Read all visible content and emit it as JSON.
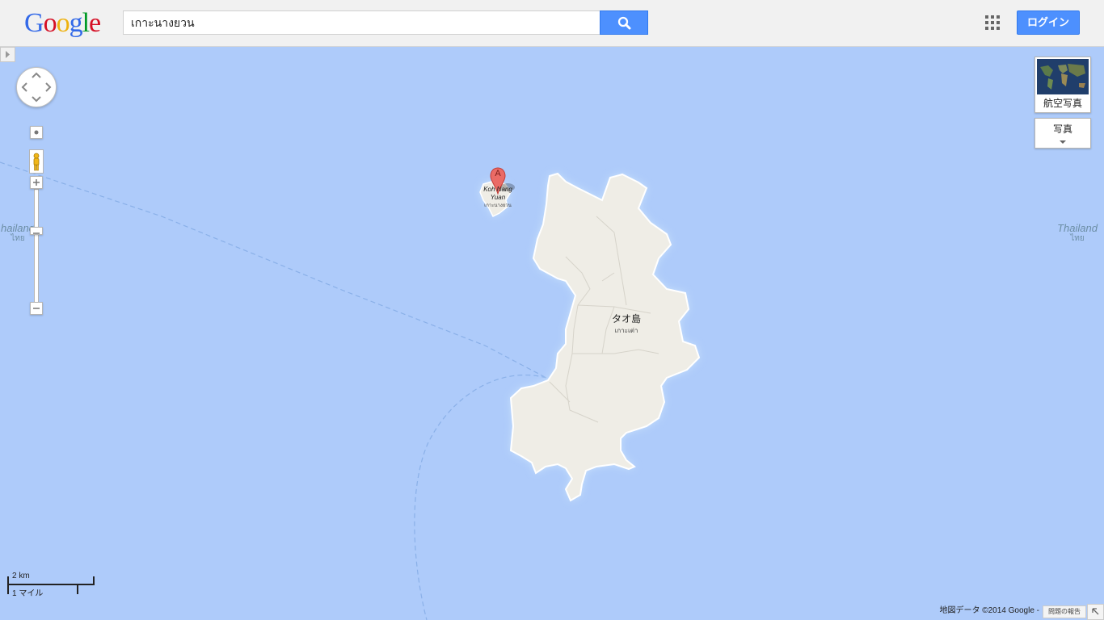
{
  "header": {
    "logo": "Google",
    "search_value": "เกาะนางยวน",
    "login_label": "ログイン"
  },
  "map": {
    "country_label_left": {
      "name": "hailand",
      "local": "ไทย"
    },
    "country_label_right": {
      "name": "Thailand",
      "local": "ไทย"
    },
    "island_label": {
      "name": "タオ島",
      "local": "เกาะเต่า"
    },
    "marker": {
      "letter": "A",
      "name": "Koh Nang Yuan",
      "local": "เกาะนางยวน"
    },
    "satellite_label": "航空写真",
    "photo_label": "写真",
    "scale_metric": "2 km",
    "scale_imperial": "1 マイル",
    "attribution": "地図データ ©2014 Google -",
    "report_label": "問題の報告",
    "colors": {
      "water": "#aecbfa",
      "land": "#efede6",
      "search_button": "#4d90fe"
    }
  }
}
